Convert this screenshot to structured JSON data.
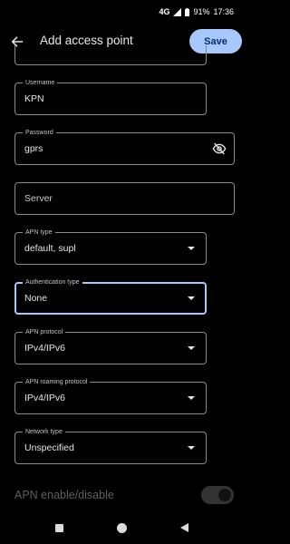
{
  "status_bar": {
    "network": "4G",
    "battery": "91%",
    "time": "17:36"
  },
  "app_bar": {
    "title": "Add access point",
    "save_label": "Save"
  },
  "fields": {
    "username": {
      "label": "Username",
      "value": "KPN"
    },
    "password": {
      "label": "Password",
      "value": "gprs"
    },
    "server": {
      "placeholder": "Server"
    },
    "apn_type": {
      "label": "APN type",
      "value": "default, supl"
    },
    "authentication_type": {
      "label": "Authentication type",
      "value": "None"
    },
    "apn_protocol": {
      "label": "APN protocol",
      "value": "IPv4/IPv6"
    },
    "apn_roaming_protocol": {
      "label": "APN roaming protocol",
      "value": "IPv4/IPv6"
    },
    "network_type": {
      "label": "Network type",
      "value": "Unspecified"
    }
  },
  "apn_toggle": {
    "label": "APN enable/disable",
    "enabled": false
  },
  "colors": {
    "background": "#000000",
    "accent": "#a8c7fa",
    "field_border": "#8b8b8b",
    "disabled_text": "#5f5f5f"
  },
  "icons": {
    "back": "arrow-left-icon",
    "visibility": "eye-off-icon",
    "signal": "signal-icon",
    "battery": "battery-icon"
  }
}
